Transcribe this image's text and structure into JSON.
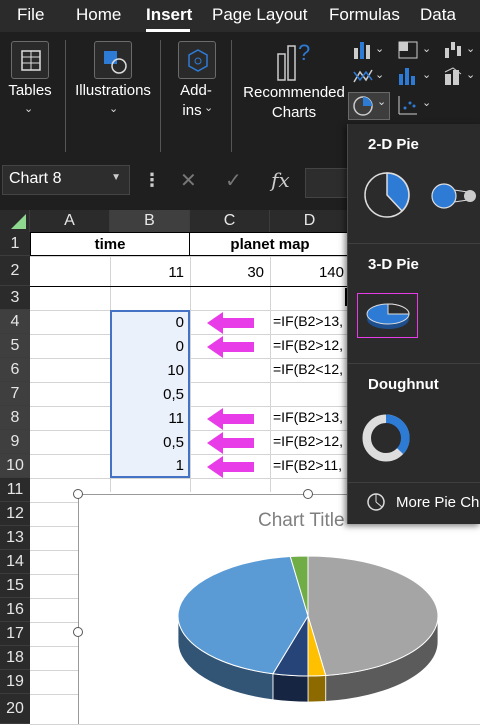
{
  "menu": {
    "tabs": [
      "File",
      "Home",
      "Insert",
      "Page Layout",
      "Formulas",
      "Data"
    ],
    "active": "Insert"
  },
  "ribbon": {
    "tables": "Tables",
    "illustrations": "Illustrations",
    "addins_line1": "Add-",
    "addins_line2": "ins",
    "recommended_line1": "Recommended",
    "recommended_line2": "Charts"
  },
  "formula_bar": {
    "name_box": "Chart 8",
    "fx": "fx"
  },
  "columns": [
    "A",
    "B",
    "C",
    "D"
  ],
  "rows": [
    "1",
    "2",
    "3",
    "4",
    "5",
    "6",
    "7",
    "8",
    "9",
    "10",
    "11",
    "12",
    "13",
    "14",
    "15",
    "16",
    "17",
    "18",
    "19",
    "20"
  ],
  "cells": {
    "r1_time": "time",
    "r1_planet": "planet map",
    "B2": "11",
    "C2": "30",
    "D2": "140",
    "B4": "0",
    "B5": "0",
    "B6": "10",
    "B7": "0,5",
    "B8": "11",
    "B9": "0,5",
    "B10": "1",
    "D4": "=IF(B2>13,",
    "D5": "=IF(B2>12,",
    "D6": "=IF(B2<12,",
    "D8": "=IF(B2>13,",
    "D9": "=IF(B2>12,",
    "D10": "=IF(B2>11,"
  },
  "dropdown": {
    "pie2d": "2-D Pie",
    "pie3d": "3-D Pie",
    "doughnut": "Doughnut",
    "more": "More Pie Cha"
  },
  "chart": {
    "title": "Chart Title"
  },
  "chart_data": {
    "type": "pie",
    "title": "Chart Title",
    "values": [
      11,
      0.5,
      1,
      10,
      0.5
    ],
    "colors": [
      "#a5a5a5",
      "#ffc000",
      "#264478",
      "#5b9bd5",
      "#70ad47"
    ]
  },
  "colors": {
    "accent": "#e83ce8",
    "selection": "#4472c4",
    "ribbon_bg": "#1f1f1f"
  }
}
